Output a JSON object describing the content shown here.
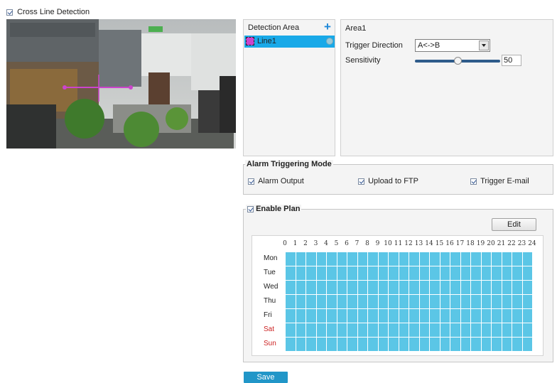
{
  "header": {
    "feature_label": "Cross Line Detection",
    "feature_checked": true
  },
  "detection_area": {
    "title": "Detection Area",
    "add_icon": "plus-icon",
    "items": [
      {
        "label": "Line1",
        "selected": true
      }
    ]
  },
  "area_settings": {
    "title": "Area1",
    "trigger_direction_label": "Trigger Direction",
    "trigger_direction_value": "A<->B",
    "sensitivity_label": "Sensitivity",
    "sensitivity_value": "50",
    "sensitivity_fraction": 0.5
  },
  "alarm_mode": {
    "title": "Alarm Triggering Mode",
    "options": [
      {
        "label": "Alarm Output",
        "checked": true
      },
      {
        "label": "Upload to FTP",
        "checked": true
      },
      {
        "label": "Trigger E-mail",
        "checked": true
      }
    ]
  },
  "plan": {
    "title": "Enable Plan",
    "enabled": true,
    "edit_label": "Edit",
    "hours": [
      "0",
      "1",
      "2",
      "3",
      "4",
      "5",
      "6",
      "7",
      "8",
      "9",
      "10",
      "11",
      "12",
      "13",
      "14",
      "15",
      "16",
      "17",
      "18",
      "19",
      "20",
      "21",
      "22",
      "23",
      "24"
    ],
    "days": [
      {
        "label": "Mon",
        "weekend": false
      },
      {
        "label": "Tue",
        "weekend": false
      },
      {
        "label": "Wed",
        "weekend": false
      },
      {
        "label": "Thu",
        "weekend": false
      },
      {
        "label": "Fri",
        "weekend": false
      },
      {
        "label": "Sat",
        "weekend": true
      },
      {
        "label": "Sun",
        "weekend": true
      }
    ]
  },
  "footer": {
    "save_label": "Save"
  },
  "colors": {
    "selected": "#19a9e8",
    "schedule": "#5bc6e6",
    "weekend": "#cc2222",
    "save": "#2196c8",
    "line_marker": "#cc44cc"
  }
}
